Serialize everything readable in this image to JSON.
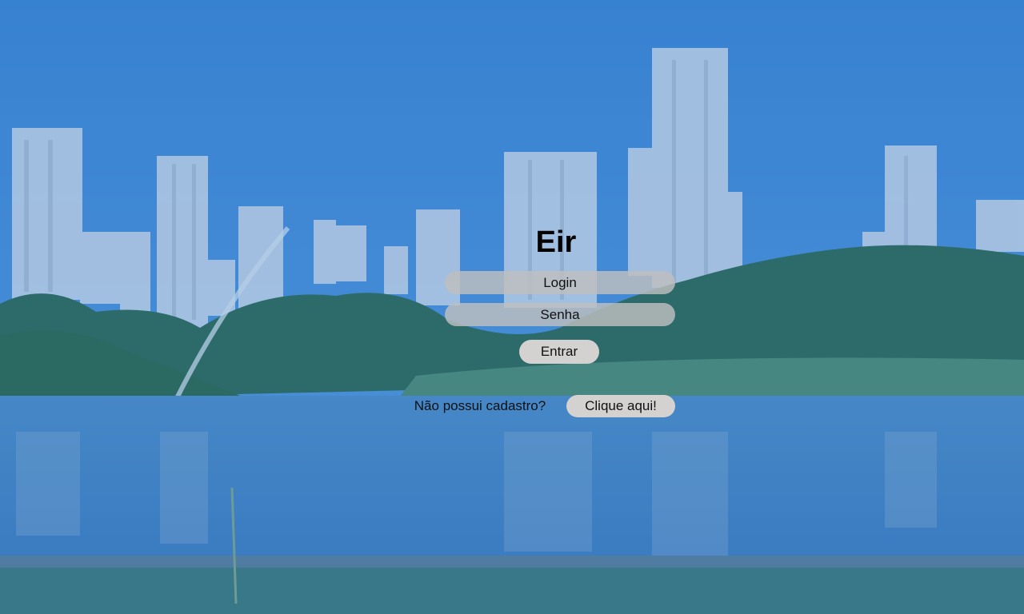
{
  "app": {
    "title": "Eir"
  },
  "form": {
    "login_placeholder": "Login",
    "password_placeholder": "Senha",
    "submit_label": "Entrar"
  },
  "signup": {
    "prompt": "Não possui cadastro?",
    "link_label": "Clique aqui!"
  },
  "theme": {
    "field_bg": "#bebebe",
    "button_bg": "#d4d2d0",
    "overlay_tint": "#3f86cf"
  }
}
